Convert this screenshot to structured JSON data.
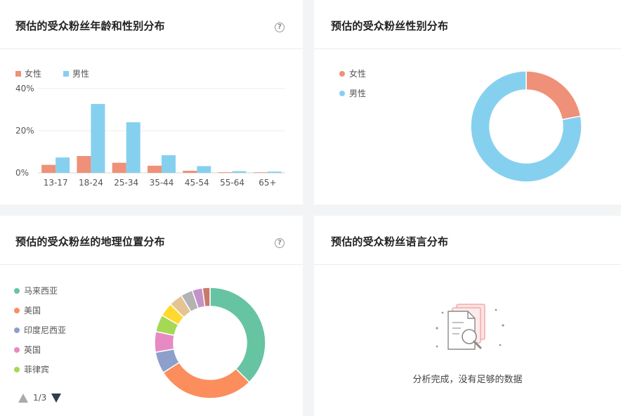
{
  "panels": {
    "age": {
      "title": "预估的受众粉丝年龄和性别分布"
    },
    "gender": {
      "title": "预估的受众粉丝性别分布"
    },
    "geo": {
      "title": "预估的受众粉丝的地理位置分布"
    },
    "language": {
      "title": "预估的受众粉丝语言分布",
      "empty_message": "分析完成，没有足够的数据"
    }
  },
  "help_glyph": "?",
  "colors": {
    "female": "#ee9178",
    "male": "#86d0ef",
    "geo_palette": [
      "#66c4a3",
      "#fc8d5c",
      "#8da0cb",
      "#e78ac3",
      "#a5d854",
      "#ffd92f",
      "#e5c494",
      "#b3b3b3",
      "#c393c8",
      "#c9786a"
    ]
  },
  "pager": {
    "label": "1/3"
  },
  "chart_data": [
    {
      "type": "bar",
      "categories": [
        "13-17",
        "18-24",
        "25-34",
        "35-44",
        "45-54",
        "55-64",
        "65+"
      ],
      "series": [
        {
          "name": "女性",
          "values": [
            3.8,
            8.0,
            4.8,
            3.4,
            1.0,
            0.3,
            0.2
          ]
        },
        {
          "name": "男性",
          "values": [
            7.3,
            32.7,
            24.0,
            8.4,
            3.2,
            0.8,
            0.6
          ]
        }
      ],
      "yticks": [
        "0%",
        "20%",
        "40%"
      ],
      "ylim": [
        0,
        40
      ],
      "legend": "top-left"
    },
    {
      "type": "pie",
      "labels": [
        "女性",
        "男性"
      ],
      "values": [
        22,
        78
      ],
      "legend": "left"
    },
    {
      "type": "pie",
      "labels": [
        "马来西亚",
        "美国",
        "印度尼西亚",
        "英国",
        "菲律宾"
      ],
      "values": [
        37.5,
        28.5,
        6.3,
        6.0,
        5.0,
        4.0,
        4.0,
        3.5,
        3.0,
        2.2
      ],
      "legend": "left"
    }
  ]
}
